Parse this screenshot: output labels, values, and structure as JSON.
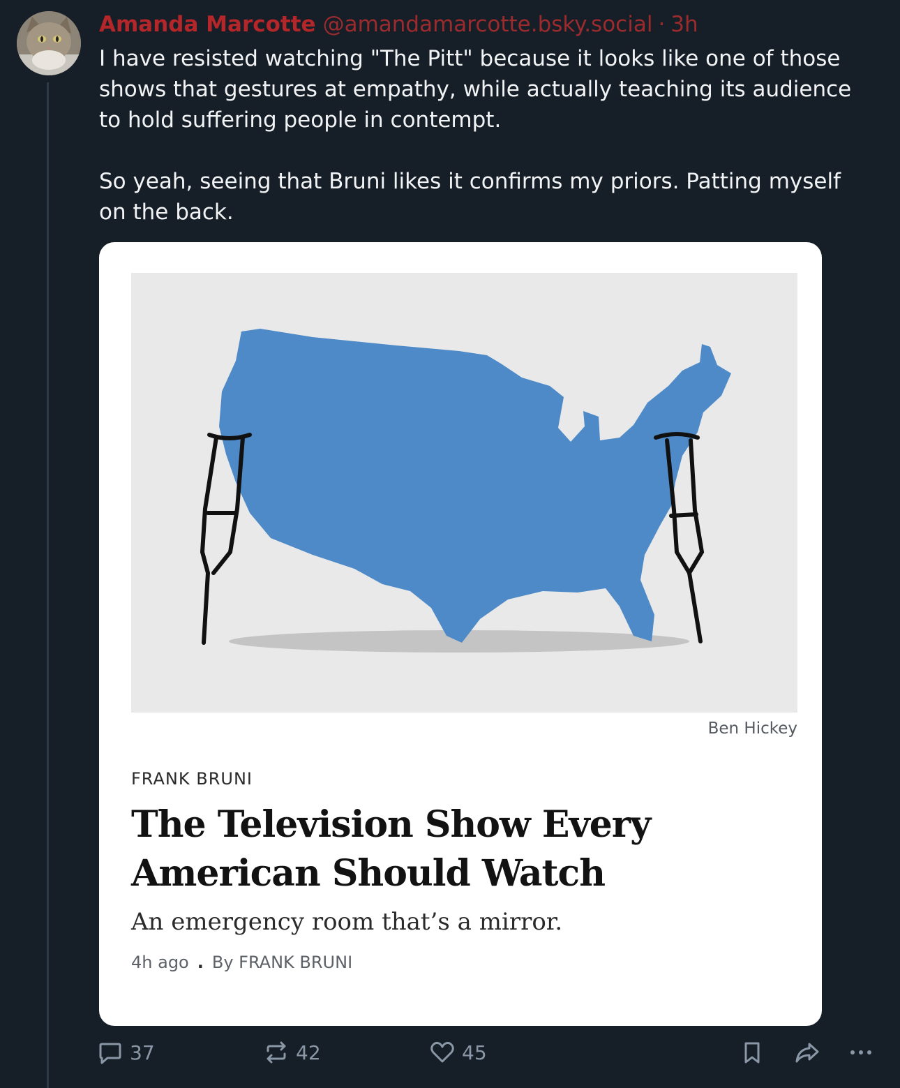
{
  "post": {
    "author_name": "Amanda Marcotte",
    "handle": "@amandamarcotte.bsky.social",
    "separator": "·",
    "time": "3h",
    "paragraphs": [
      "I have resisted watching \"The Pitt\" because it looks like one of those shows that gestures at empathy, while actually teaching its audience to hold suffering people in contempt.",
      "So yeah, seeing that Bruni likes it confirms my priors. Patting myself on the back."
    ]
  },
  "card": {
    "image_credit": "Ben Hickey",
    "kicker": "FRANK BRUNI",
    "headline": "The Television Show Every American Should Watch",
    "summary": "An emergency room that’s a mirror.",
    "age": "4h ago",
    "meta_separator": ".",
    "byline": "By FRANK BRUNI"
  },
  "actions": {
    "replies": "37",
    "reposts": "42",
    "likes": "45"
  },
  "icons": {
    "reply": "speech-bubble-icon",
    "repost": "repost-arrows-icon",
    "like": "heart-icon",
    "bookmark": "bookmark-icon",
    "share": "share-arrow-icon",
    "more": "more-dots-icon"
  },
  "colors": {
    "background": "#161e27",
    "author": "#b3262a",
    "text": "#f1f3f5",
    "action": "#8a97a6",
    "map_blue": "#4e8ac8"
  }
}
